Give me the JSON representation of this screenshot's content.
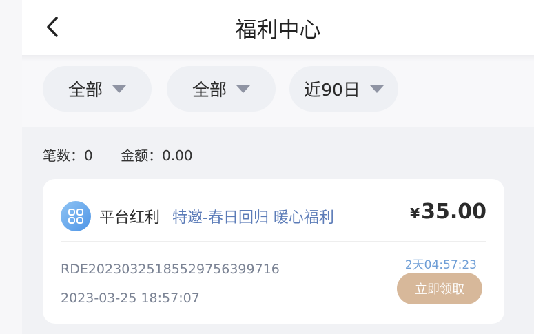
{
  "header": {
    "title": "福利中心",
    "back_icon": "chevron-left-icon"
  },
  "filters": [
    {
      "label": "全部",
      "icon": "caret-down-icon"
    },
    {
      "label": "全部",
      "icon": "caret-down-icon"
    },
    {
      "label": "近90日",
      "icon": "caret-down-icon"
    }
  ],
  "summary": {
    "count_label": "笔数：0",
    "amount_label": "金额：0.00"
  },
  "card": {
    "icon": "grid-apps-icon",
    "category": "平台红利",
    "description": "特邀-春日回归 暖心福利",
    "currency": "¥",
    "amount": "35.00",
    "order_no": "RDE20230325185529756399716",
    "time": "2023-03-25 18:57:07",
    "countdown": "2天04:57:23",
    "claim_label": "立即领取",
    "colors": {
      "claim_button": "#d7b89a",
      "countdown": "#6f9ed6",
      "description": "#5c7cb8",
      "icon": "#4d94e6"
    }
  }
}
